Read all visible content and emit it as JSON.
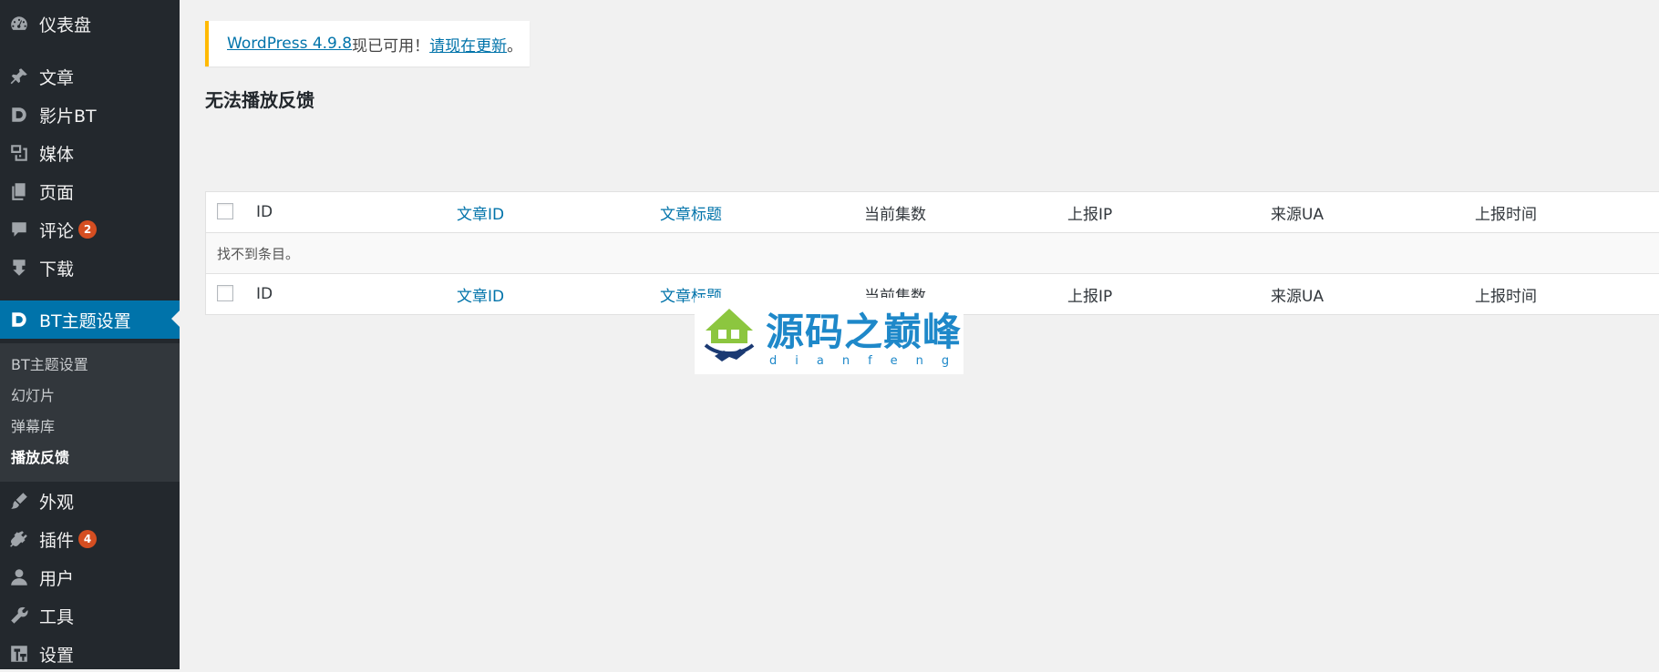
{
  "sidebar": {
    "items": [
      {
        "label": "仪表盘",
        "icon": "dashboard-icon"
      },
      {
        "label": "文章",
        "icon": "pin-icon"
      },
      {
        "label": "影片BT",
        "icon": "d-logo-icon"
      },
      {
        "label": "媒体",
        "icon": "media-icon"
      },
      {
        "label": "页面",
        "icon": "pages-icon"
      },
      {
        "label": "评论",
        "icon": "comment-icon",
        "badge": "2"
      },
      {
        "label": "下载",
        "icon": "download-icon"
      },
      {
        "label": "BT主题设置",
        "icon": "d-logo-icon"
      },
      {
        "label": "外观",
        "icon": "brush-icon"
      },
      {
        "label": "插件",
        "icon": "plugin-icon",
        "badge": "4"
      },
      {
        "label": "用户",
        "icon": "user-icon"
      },
      {
        "label": "工具",
        "icon": "wrench-icon"
      },
      {
        "label": "设置",
        "icon": "settings-icon"
      }
    ],
    "submenu": [
      "BT主题设置",
      "幻灯片",
      "弹幕库",
      "播放反馈"
    ]
  },
  "notice": {
    "link1": "WordPress 4.9.8",
    "middle": "现已可用！",
    "link2": "请现在更新",
    "end": "。"
  },
  "page_title": "无法播放反馈",
  "table": {
    "columns": [
      "ID",
      "文章ID",
      "文章标题",
      "当前集数",
      "上报IP",
      "来源UA",
      "上报时间"
    ],
    "empty_message": "找不到条目。"
  },
  "watermark": {
    "title": "源码之巅峰",
    "subtitle": "dianfeng"
  },
  "colors": {
    "sidebar_bg": "#23282d",
    "accent": "#0073aa",
    "badge": "#d54e21",
    "notice_border": "#ffb900"
  }
}
